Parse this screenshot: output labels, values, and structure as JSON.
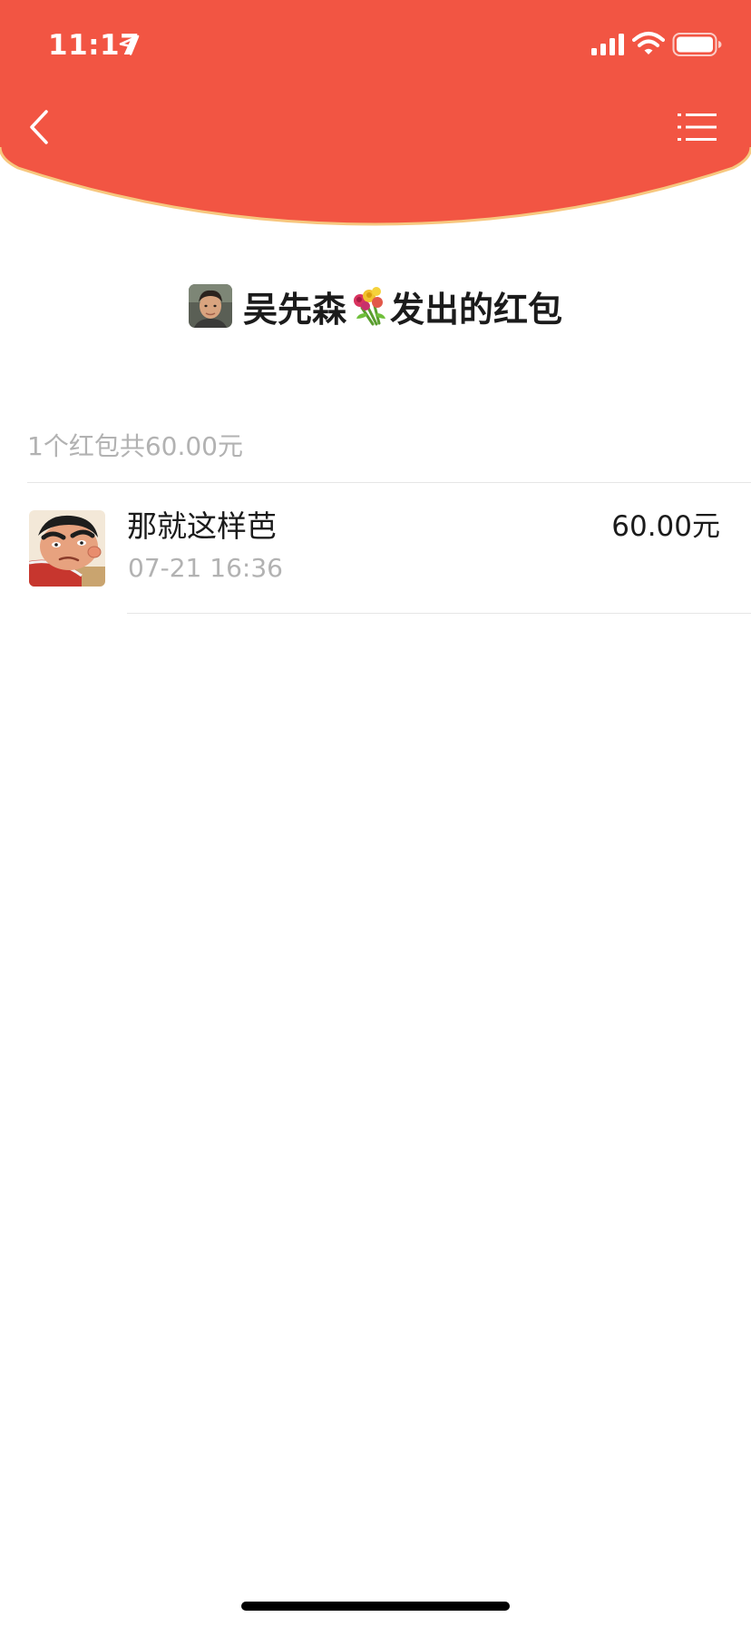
{
  "colors": {
    "header_red": "#F25543",
    "header_edge": "#F7C77E",
    "primary_text": "#1B1B1B",
    "secondary_text": "#B2B2B2",
    "divider": "#E6E6E6"
  },
  "status_bar": {
    "time": "11:17",
    "icons": [
      "location-arrow-icon",
      "cellular-signal-icon",
      "wifi-icon",
      "battery-icon"
    ]
  },
  "nav": {
    "back_icon": "chevron-left-icon",
    "menu_icon": "list-menu-icon"
  },
  "header": {
    "sender_name": "吴先森",
    "sender_emoji": "bouquet-icon",
    "title_suffix": "发出的红包"
  },
  "summary": {
    "text": "1个红包共60.00元"
  },
  "records": [
    {
      "name": "那就这样芭",
      "time": "07-21 16:36",
      "amount": "60.00元"
    }
  ]
}
